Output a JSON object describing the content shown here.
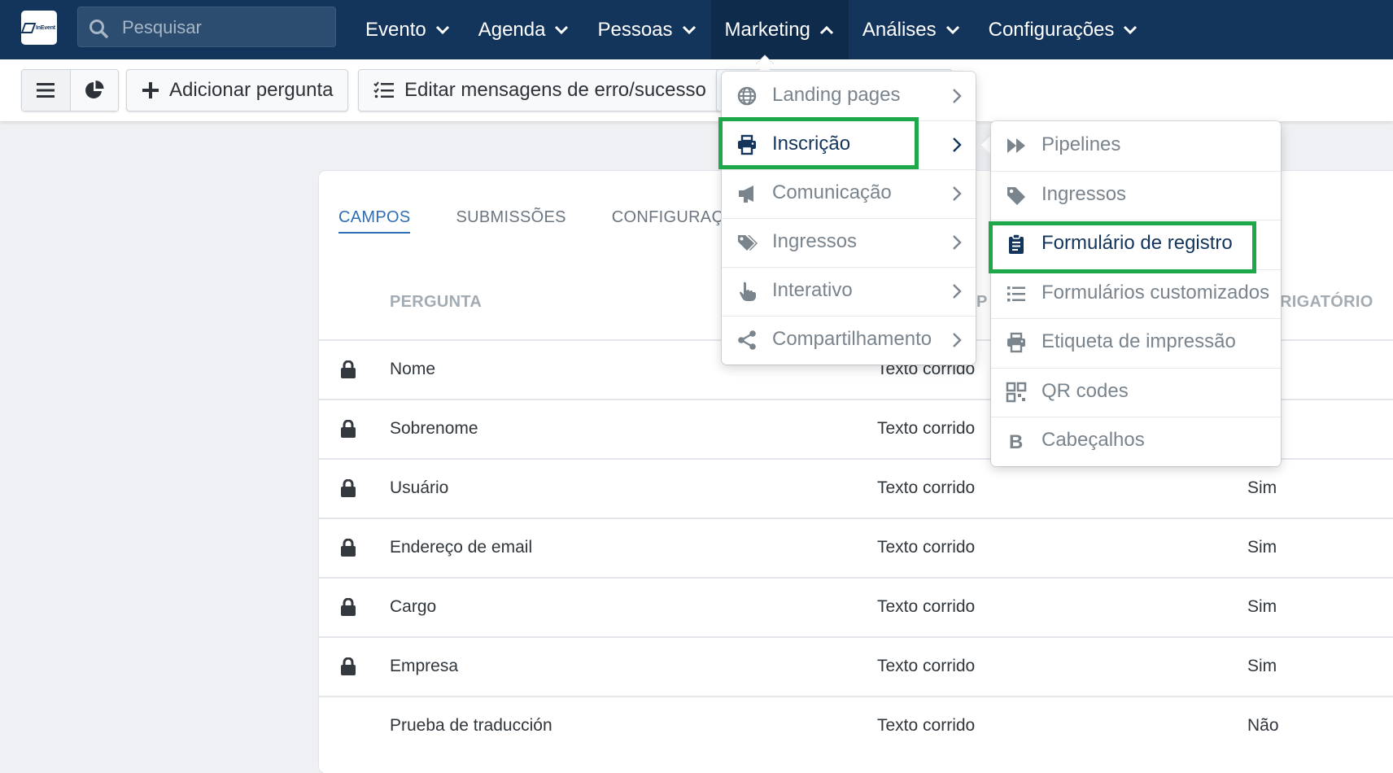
{
  "app": {
    "logo_text": "InEvent"
  },
  "search": {
    "placeholder": "Pesquisar"
  },
  "nav": [
    {
      "label": "Evento",
      "active": false
    },
    {
      "label": "Agenda",
      "active": false
    },
    {
      "label": "Pessoas",
      "active": false
    },
    {
      "label": "Marketing",
      "active": true
    },
    {
      "label": "Análises",
      "active": false
    },
    {
      "label": "Configurações",
      "active": false
    }
  ],
  "toolbar": {
    "add_question_label": "Adicionar pergunta",
    "edit_messages_label": "Editar mensagens de erro/sucesso"
  },
  "tabs": [
    {
      "label": "CAMPOS",
      "active": true
    },
    {
      "label": "SUBMISSÕES",
      "active": false
    },
    {
      "label": "CONFIGURAÇÕ",
      "active": false
    }
  ],
  "table": {
    "headers": {
      "question": "PERGUNTA",
      "type": "P",
      "required": "RIGATÓRIO"
    },
    "rows": [
      {
        "question": "Nome",
        "type": "Texto corrido",
        "required": "",
        "locked": true
      },
      {
        "question": "Sobrenome",
        "type": "Texto corrido",
        "required": "",
        "locked": true
      },
      {
        "question": "Usuário",
        "type": "Texto corrido",
        "required": "Sim",
        "locked": true
      },
      {
        "question": "Endereço de email",
        "type": "Texto corrido",
        "required": "Sim",
        "locked": true
      },
      {
        "question": "Cargo",
        "type": "Texto corrido",
        "required": "Sim",
        "locked": true
      },
      {
        "question": "Empresa",
        "type": "Texto corrido",
        "required": "Sim",
        "locked": true
      },
      {
        "question": "Prueba de traducción",
        "type": "Texto corrido",
        "required": "Não",
        "locked": false
      }
    ]
  },
  "marketing_menu": [
    {
      "label": "Landing pages",
      "icon": "globe-icon"
    },
    {
      "label": "Inscrição",
      "icon": "printer-icon",
      "selected": true
    },
    {
      "label": "Comunicação",
      "icon": "megaphone-icon"
    },
    {
      "label": "Ingressos",
      "icon": "tags-icon"
    },
    {
      "label": "Interativo",
      "icon": "pointer-hand-icon"
    },
    {
      "label": "Compartilhamento",
      "icon": "share-icon"
    }
  ],
  "inscricao_submenu": [
    {
      "label": "Pipelines",
      "icon": "fast-forward-icon"
    },
    {
      "label": "Ingressos",
      "icon": "tag-icon"
    },
    {
      "label": "Formulário de registro",
      "icon": "clipboard-icon",
      "selected": true
    },
    {
      "label": "Formulários customizados",
      "icon": "list-icon"
    },
    {
      "label": "Etiqueta de impressão",
      "icon": "printer-icon"
    },
    {
      "label": "QR codes",
      "icon": "qrcode-icon"
    },
    {
      "label": "Cabeçalhos",
      "icon": "bold-icon"
    }
  ],
  "colors": {
    "nav_bg": "#13355c",
    "accent": "#2d6eb5",
    "highlight": "#1fa84a",
    "menu_text": "#7a848d",
    "selected_text": "#13355c"
  }
}
